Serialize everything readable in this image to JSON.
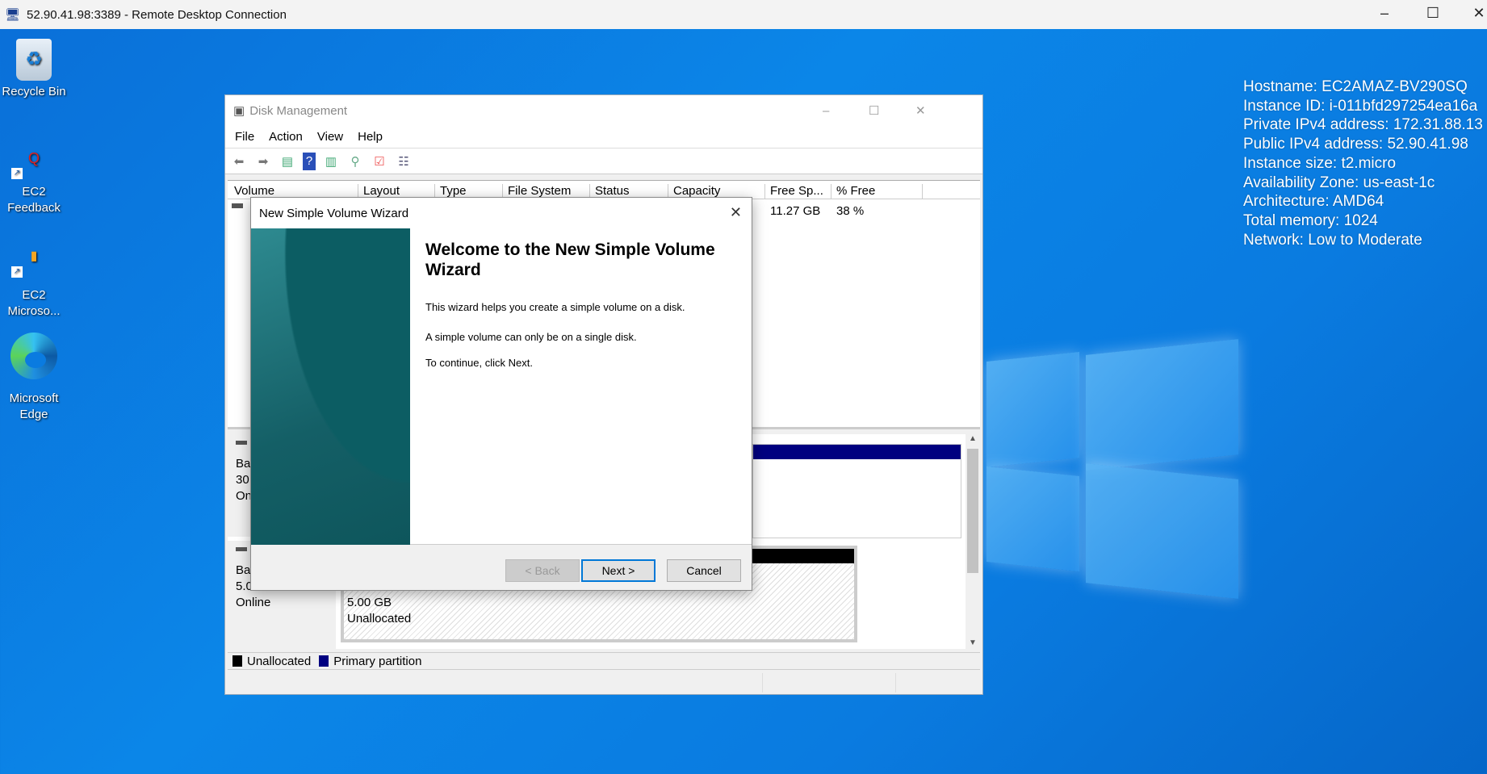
{
  "rdp": {
    "title": "52.90.41.98:3389 - Remote Desktop Connection"
  },
  "desktop": {
    "icons": [
      {
        "label": "Recycle Bin",
        "icon": "recycle-bin-icon"
      },
      {
        "label": "EC2\nFeedback",
        "line1": "EC2",
        "line2": "Feedback",
        "icon": "feedback-icon"
      },
      {
        "line1": "EC2",
        "line2": "Microso...",
        "icon": "ec2-icon"
      },
      {
        "line1": "Microsoft",
        "line2": "Edge",
        "icon": "edge-icon"
      }
    ]
  },
  "info": [
    "Hostname: EC2AMAZ-BV290SQ",
    "Instance ID: i-011bfd297254ea16a",
    "Private IPv4 address: 172.31.88.13",
    "Public IPv4 address: 52.90.41.98",
    "Instance size: t2.micro",
    "Availability Zone: us-east-1c",
    "Architecture: AMD64",
    "Total memory: 1024",
    "Network: Low to Moderate"
  ],
  "dm": {
    "title": "Disk Management",
    "menu": [
      "File",
      "Action",
      "View",
      "Help"
    ],
    "columns": [
      "Volume",
      "Layout",
      "Type",
      "File System",
      "Status",
      "Capacity",
      "Free Sp...",
      "% Free"
    ],
    "row": {
      "free": "11.27 GB",
      "pct_free": "38 %"
    },
    "disk0": {
      "l1": "Ba",
      "l2": "30",
      "l3": "On"
    },
    "disk1": {
      "l1": "Ba",
      "l2": "5.00 GB",
      "l3": "Online",
      "part_size": "5.00 GB",
      "part_status": "Unallocated"
    },
    "legend": {
      "unallocated": "Unallocated",
      "primary": "Primary partition"
    },
    "colors": {
      "unallocated": "#000000",
      "primary": "#000080"
    }
  },
  "wizard": {
    "title": "New Simple Volume Wizard",
    "heading": "Welcome to the New Simple Volume Wizard",
    "p1": "This wizard helps you create a simple volume on a disk.",
    "p2": "A simple volume can only be on a single disk.",
    "p3": "To continue, click Next.",
    "back": "< Back",
    "next": "Next >",
    "cancel": "Cancel"
  }
}
